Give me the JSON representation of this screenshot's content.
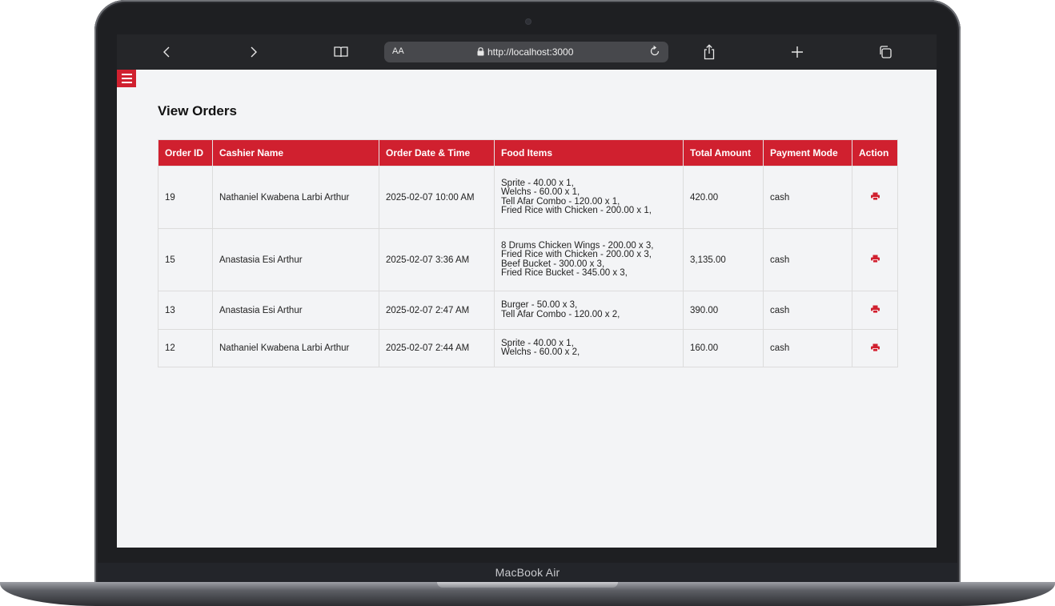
{
  "device": {
    "label": "MacBook Air"
  },
  "browser": {
    "text_size_label": "AA",
    "url": "http://localhost:3000",
    "icons": [
      "back-icon",
      "forward-icon",
      "bookmarks-icon",
      "lock-icon",
      "reload-icon",
      "share-icon",
      "new-tab-icon",
      "tabs-icon"
    ]
  },
  "colors": {
    "accent": "#d0202f",
    "page_bg": "#f3f4f6",
    "browser_bar": "#252629"
  },
  "page": {
    "title": "View Orders",
    "menu_icon": "hamburger-menu-icon"
  },
  "table": {
    "headers": [
      "Order ID",
      "Cashier Name",
      "Order Date & Time",
      "Food Items",
      "Total Amount",
      "Payment Mode",
      "Action"
    ],
    "rows": [
      {
        "order_id": "19",
        "cashier": "Nathaniel Kwabena Larbi Arthur",
        "datetime": "2025-02-07 10:00 AM",
        "items": [
          "Sprite - 40.00 x 1,",
          "Welchs - 60.00 x 1,",
          "Tell Afar Combo - 120.00 x 1,",
          "Fried Rice with Chicken - 200.00 x 1,"
        ],
        "total": "420.00",
        "payment": "cash"
      },
      {
        "order_id": "15",
        "cashier": "Anastasia Esi Arthur",
        "datetime": "2025-02-07 3:36 AM",
        "items": [
          "8 Drums Chicken Wings - 200.00 x 3,",
          "Fried Rice with Chicken - 200.00 x 3,",
          "Beef Bucket - 300.00 x 3,",
          "Fried Rice Bucket - 345.00 x 3,"
        ],
        "total": "3,135.00",
        "payment": "cash"
      },
      {
        "order_id": "13",
        "cashier": "Anastasia Esi Arthur",
        "datetime": "2025-02-07 2:47 AM",
        "items": [
          "Burger - 50.00 x 3,",
          "Tell Afar Combo - 120.00 x 2,"
        ],
        "total": "390.00",
        "payment": "cash"
      },
      {
        "order_id": "12",
        "cashier": "Nathaniel Kwabena Larbi Arthur",
        "datetime": "2025-02-07 2:44 AM",
        "items": [
          "Sprite - 40.00 x 1,",
          "Welchs - 60.00 x 2,"
        ],
        "total": "160.00",
        "payment": "cash"
      }
    ],
    "action_icon": "print-icon"
  }
}
